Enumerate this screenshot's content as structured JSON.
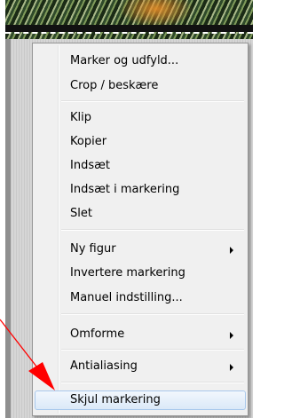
{
  "menu": {
    "groups": [
      [
        {
          "label": "Marker og udfyld..."
        },
        {
          "label": "Crop / beskære"
        }
      ],
      [
        {
          "label": "Klip"
        },
        {
          "label": "Kopier"
        },
        {
          "label": "Indsæt"
        },
        {
          "label": "Indsæt i markering"
        },
        {
          "label": "Slet"
        }
      ],
      [
        {
          "label": "Ny figur",
          "submenu": true
        },
        {
          "label": "Invertere markering"
        },
        {
          "label": "Manuel indstilling..."
        }
      ],
      [
        {
          "label": "Omforme",
          "submenu": true
        }
      ],
      [
        {
          "label": "Antialiasing",
          "submenu": true
        }
      ],
      [
        {
          "label": "Skjul markering",
          "highlighted": true
        }
      ]
    ]
  },
  "colors": {
    "menu_bg": "#f0f0f0",
    "highlight": "#dbe9f8",
    "annotation_arrow": "#ff0000"
  }
}
